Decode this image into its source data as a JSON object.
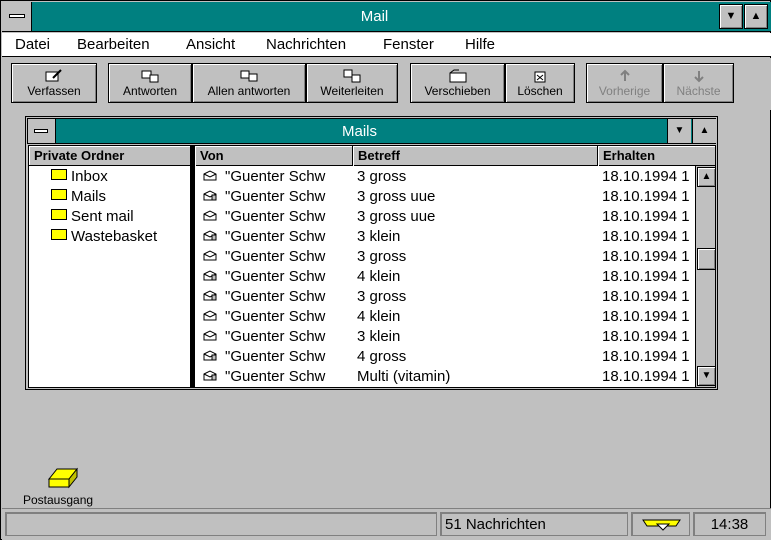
{
  "window": {
    "title": "Mail"
  },
  "menu": [
    "Datei",
    "Bearbeiten",
    "Ansicht",
    "Nachrichten",
    "Fenster",
    "Hilfe"
  ],
  "toolbar": {
    "compose": "Verfassen",
    "reply": "Antworten",
    "reply_all": "Allen antworten",
    "forward": "Weiterleiten",
    "move": "Verschieben",
    "delete": "Löschen",
    "previous": "Vorherige",
    "next": "Nächste"
  },
  "child_window": {
    "title": "Mails"
  },
  "folders": {
    "header": "Private Ordner",
    "items": [
      "Inbox",
      "Mails",
      "Sent mail",
      "Wastebasket"
    ]
  },
  "list": {
    "columns": [
      "Von",
      "Betreff",
      "Erhalten"
    ],
    "rows": [
      {
        "from": "\"Guenter Schw",
        "subject": "3 gross",
        "date": "18.10.1994 1",
        "icon": "mail-closed-icon"
      },
      {
        "from": "\"Guenter Schw",
        "subject": "3 gross uue",
        "date": "18.10.1994 1",
        "icon": "mail-attachment-icon"
      },
      {
        "from": "\"Guenter Schw",
        "subject": "3 gross uue",
        "date": "18.10.1994 1",
        "icon": "mail-closed-icon"
      },
      {
        "from": "\"Guenter Schw",
        "subject": "3 klein",
        "date": "18.10.1994 1",
        "icon": "mail-attachment-icon"
      },
      {
        "from": "\"Guenter Schw",
        "subject": "3 gross",
        "date": "18.10.1994 1",
        "icon": "mail-closed-icon"
      },
      {
        "from": "\"Guenter Schw",
        "subject": "4 klein",
        "date": "18.10.1994 1",
        "icon": "mail-attachment-icon"
      },
      {
        "from": "\"Guenter Schw",
        "subject": "3 gross",
        "date": "18.10.1994 1",
        "icon": "mail-attachment-icon"
      },
      {
        "from": "\"Guenter Schw",
        "subject": "4 klein",
        "date": "18.10.1994 1",
        "icon": "mail-closed-icon"
      },
      {
        "from": "\"Guenter Schw",
        "subject": "3 klein",
        "date": "18.10.1994 1",
        "icon": "mail-closed-icon"
      },
      {
        "from": "\"Guenter Schw",
        "subject": "4 gross",
        "date": "18.10.1994 1",
        "icon": "mail-attachment-icon"
      },
      {
        "from": "\"Guenter Schw",
        "subject": "Multi (vitamin)",
        "date": "18.10.1994 1",
        "icon": "mail-attachment-icon"
      }
    ]
  },
  "desktop": {
    "outbox_label": "Postausgang"
  },
  "status": {
    "count": "51 Nachrichten",
    "time": "14:38"
  }
}
